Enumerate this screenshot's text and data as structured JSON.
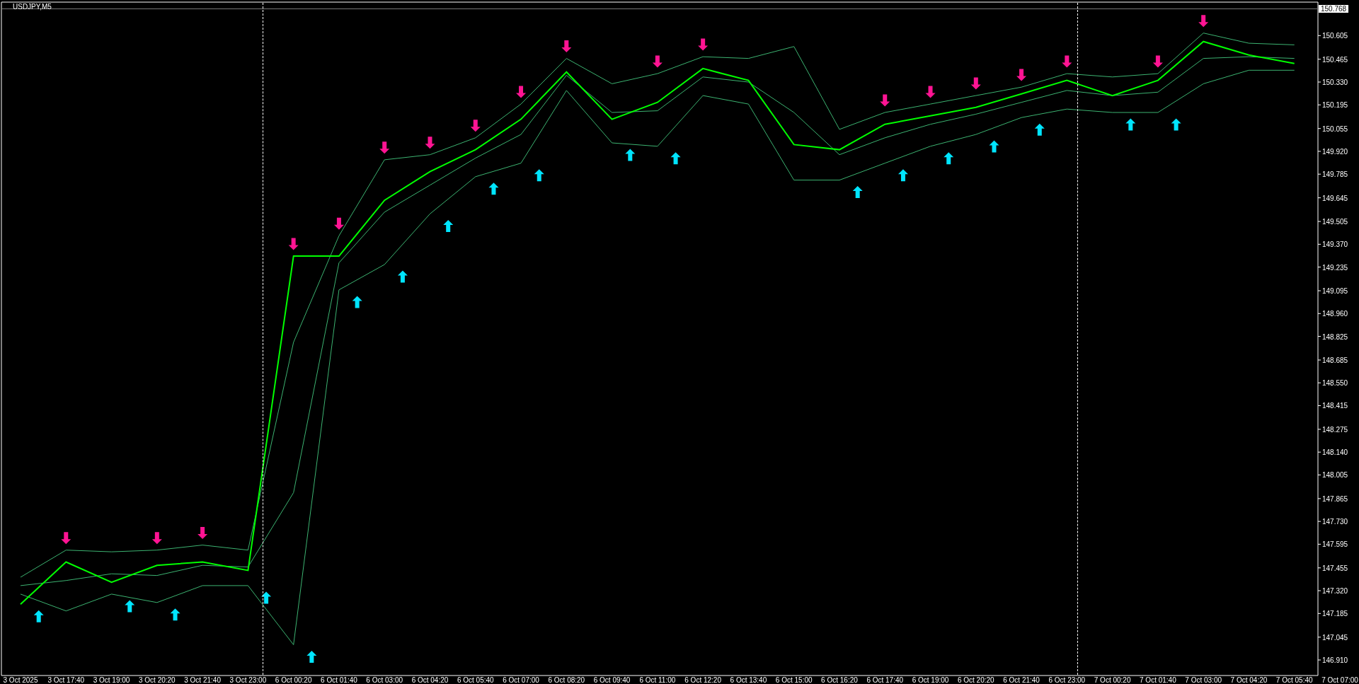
{
  "window": {
    "title": "USDJPY,M5"
  },
  "current_price": "150.768",
  "chart_data": {
    "type": "line",
    "x": [
      "3 Oct 2025",
      "3 Oct 17:40",
      "3 Oct 19:00",
      "3 Oct 20:20",
      "3 Oct 21:40",
      "3 Oct 23:00",
      "6 Oct 00:20",
      "6 Oct 01:40",
      "6 Oct 03:00",
      "6 Oct 04:20",
      "6 Oct 05:40",
      "6 Oct 07:00",
      "6 Oct 08:20",
      "6 Oct 09:40",
      "6 Oct 11:00",
      "6 Oct 12:20",
      "6 Oct 13:40",
      "6 Oct 15:00",
      "6 Oct 16:20",
      "6 Oct 17:40",
      "6 Oct 19:00",
      "6 Oct 20:20",
      "6 Oct 21:40",
      "6 Oct 23:00",
      "7 Oct 00:20",
      "7 Oct 01:40",
      "7 Oct 03:00",
      "7 Oct 04:20",
      "7 Oct 05:40",
      "7 Oct 07:00"
    ],
    "series": [
      {
        "color": "#3cb371",
        "values": [
          147.4,
          147.56,
          147.55,
          147.56,
          147.59,
          147.56,
          148.79,
          149.42,
          149.87,
          149.9,
          150.0,
          150.2,
          150.47,
          150.32,
          150.38,
          150.48,
          150.47,
          150.54,
          150.05,
          150.15,
          150.2,
          150.25,
          150.3,
          150.38,
          150.36,
          150.38,
          150.62,
          150.56,
          150.55,
          null
        ]
      },
      {
        "color": "#3cb371",
        "values": [
          147.35,
          147.38,
          147.42,
          147.41,
          147.47,
          147.46,
          147.9,
          149.26,
          149.56,
          149.72,
          149.88,
          150.02,
          150.37,
          150.15,
          150.16,
          150.36,
          150.33,
          150.15,
          149.9,
          150.0,
          150.08,
          150.14,
          150.21,
          150.28,
          150.25,
          150.27,
          150.47,
          150.48,
          150.47,
          null
        ]
      },
      {
        "color": "#3cb371",
        "values": [
          147.3,
          147.2,
          147.3,
          147.25,
          147.35,
          147.35,
          147.0,
          149.1,
          149.25,
          149.55,
          149.77,
          149.85,
          150.28,
          149.97,
          149.95,
          150.25,
          150.2,
          149.75,
          149.75,
          149.85,
          149.95,
          150.02,
          150.12,
          150.17,
          150.15,
          150.15,
          150.32,
          150.4,
          150.4,
          null
        ]
      },
      {
        "color": "#00ff00",
        "values": [
          147.24,
          147.49,
          147.37,
          147.47,
          147.49,
          147.44,
          149.3,
          149.3,
          149.63,
          149.8,
          149.93,
          150.11,
          150.39,
          150.11,
          150.21,
          150.41,
          150.34,
          149.96,
          149.93,
          150.08,
          150.13,
          150.18,
          150.26,
          150.34,
          150.25,
          150.34,
          150.57,
          150.49,
          150.44,
          null
        ]
      }
    ],
    "ylim": [
      146.818,
      150.803
    ],
    "yticks": [
      {
        "value": 150.605,
        "label": "150.605"
      },
      {
        "value": 150.465,
        "label": "150.465"
      },
      {
        "value": 150.33,
        "label": "150.330"
      },
      {
        "value": 150.195,
        "label": "150.195"
      },
      {
        "value": 150.055,
        "label": "150.055"
      },
      {
        "value": 149.92,
        "label": "149.920"
      },
      {
        "value": 149.785,
        "label": "149.785"
      },
      {
        "value": 149.645,
        "label": "149.645"
      },
      {
        "value": 149.505,
        "label": "149.505"
      },
      {
        "value": 149.37,
        "label": "149.370"
      },
      {
        "value": 149.235,
        "label": "149.235"
      },
      {
        "value": 149.095,
        "label": "149.095"
      },
      {
        "value": 148.96,
        "label": "148.960"
      },
      {
        "value": 148.825,
        "label": "148.825"
      },
      {
        "value": 148.685,
        "label": "148.685"
      },
      {
        "value": 148.55,
        "label": "148.550"
      },
      {
        "value": 148.415,
        "label": "148.415"
      },
      {
        "value": 148.275,
        "label": "148.275"
      },
      {
        "value": 148.14,
        "label": "148.140"
      },
      {
        "value": 148.005,
        "label": "148.005"
      },
      {
        "value": 147.865,
        "label": "147.865"
      },
      {
        "value": 147.73,
        "label": "147.730"
      },
      {
        "value": 147.595,
        "label": "147.595"
      },
      {
        "value": 147.455,
        "label": "147.455"
      },
      {
        "value": 147.32,
        "label": "147.320"
      },
      {
        "value": 147.185,
        "label": "147.185"
      },
      {
        "value": 147.045,
        "label": "147.045"
      },
      {
        "value": 146.91,
        "label": "146.910"
      }
    ]
  }
}
